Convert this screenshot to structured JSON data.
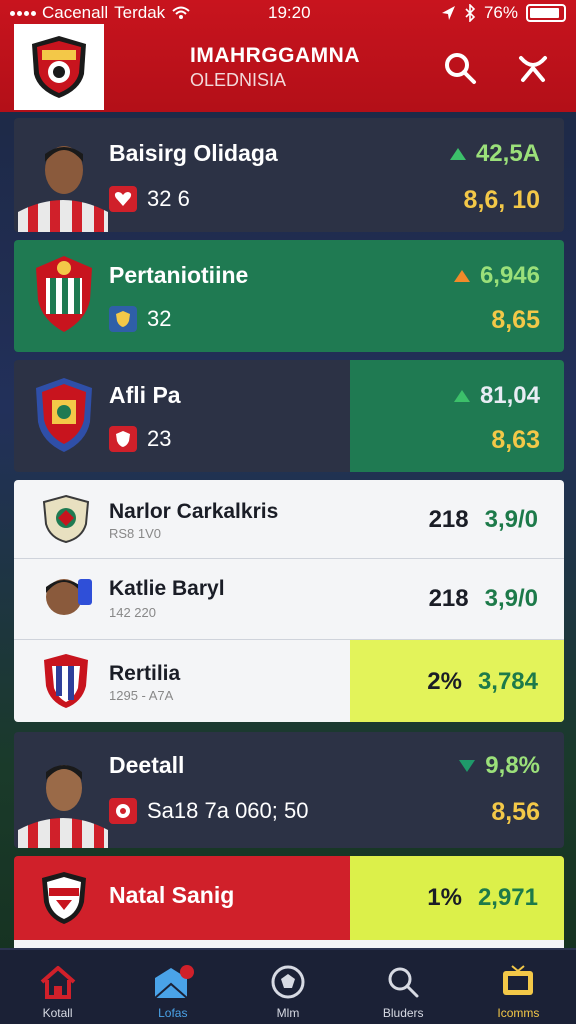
{
  "status_bar": {
    "carrier": "Cacenall",
    "network": "Terdak",
    "time": "19:20",
    "battery": "76%"
  },
  "header": {
    "title": "IMAHRGGAMNA",
    "subtitle": "OLEDNISIA"
  },
  "cards": [
    {
      "name": "Baisirg Olidaga",
      "sub": "32 6",
      "right_top": "42,5A",
      "right_bot": "8,6, 10"
    },
    {
      "name": "Pertaniotiine",
      "sub": "32",
      "right_top": "6,946",
      "right_bot": "8,65"
    },
    {
      "name": "Afli Pa",
      "sub": "23",
      "right_top": "81,04",
      "right_bot": "8,63"
    },
    {
      "name": "Narlor Carkalkris",
      "meta": "RS8   1V0",
      "val1": "218",
      "val2": "3,9/0"
    },
    {
      "name": "Katlie Baryl",
      "meta": "142   220",
      "val1": "218",
      "val2": "3,9/0"
    },
    {
      "name": "Rertilia",
      "meta": "1295 - A7A",
      "val1": "2%",
      "val2": "3,784"
    },
    {
      "name": "Deetall",
      "sub": "Sa18 7a 060; 50",
      "right_top": "9,8%",
      "right_bot": "8,56"
    },
    {
      "name": "Natal Sanig",
      "val1": "1%",
      "val2": "2,971"
    }
  ],
  "nav": [
    {
      "label": "Kotall",
      "icon": "home-icon"
    },
    {
      "label": "Lofas",
      "icon": "inbox-icon"
    },
    {
      "label": "Mlm",
      "icon": "match-icon"
    },
    {
      "label": "Bluders",
      "icon": "search-icon"
    },
    {
      "label": "Icomms",
      "icon": "tv-icon"
    }
  ],
  "colors": {
    "header_red": "#c8141e",
    "card_dark": "#2c3245",
    "card_green": "#1f7a52",
    "accent_yellow": "#f3c848",
    "accent_lime": "#dcf04a"
  }
}
